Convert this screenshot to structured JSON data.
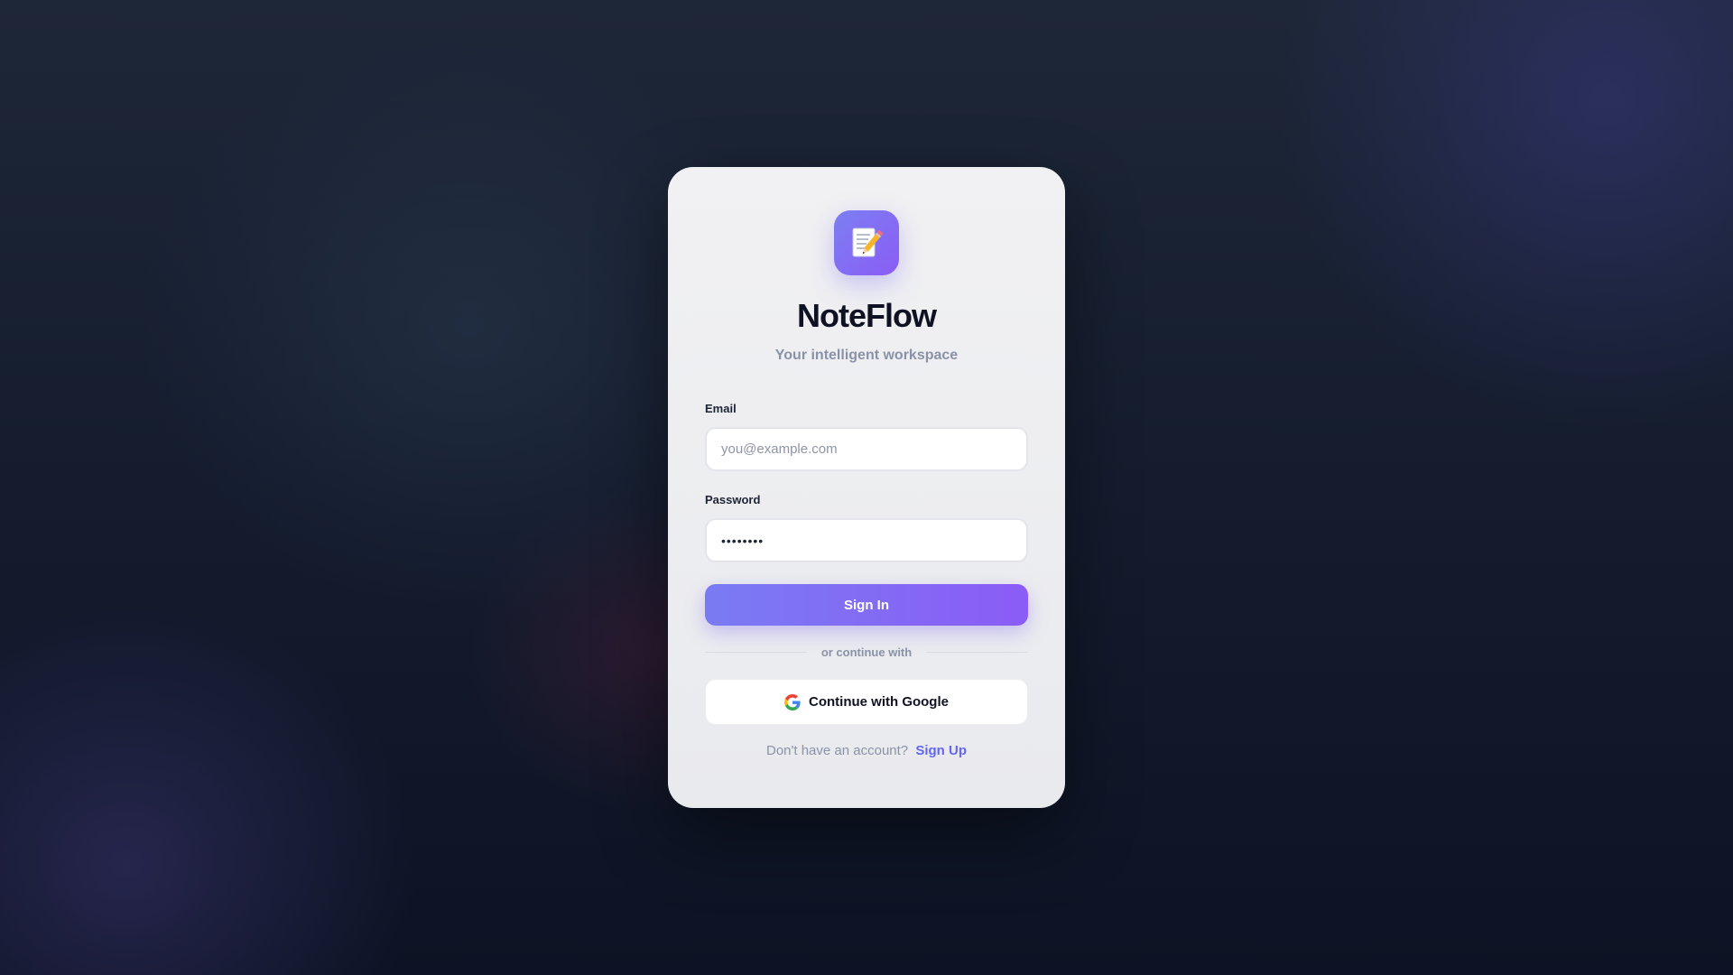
{
  "app": {
    "logo_icon": "memo-pencil-icon",
    "title": "NoteFlow",
    "subtitle": "Your intelligent workspace"
  },
  "form": {
    "email_label": "Email",
    "email_placeholder": "you@example.com",
    "email_value": "",
    "password_label": "Password",
    "password_value": "••••••••",
    "signin_label": "Sign In",
    "divider_text": "or continue with",
    "google_label": "Continue with Google",
    "google_icon": "google-icon"
  },
  "footer": {
    "prompt": "Don't have an account?",
    "signup_label": "Sign Up"
  },
  "colors": {
    "accent": "#6366f1",
    "accent_gradient_end": "#8b5cf6",
    "background": "#0f172a",
    "card": "#f1f1f3"
  }
}
